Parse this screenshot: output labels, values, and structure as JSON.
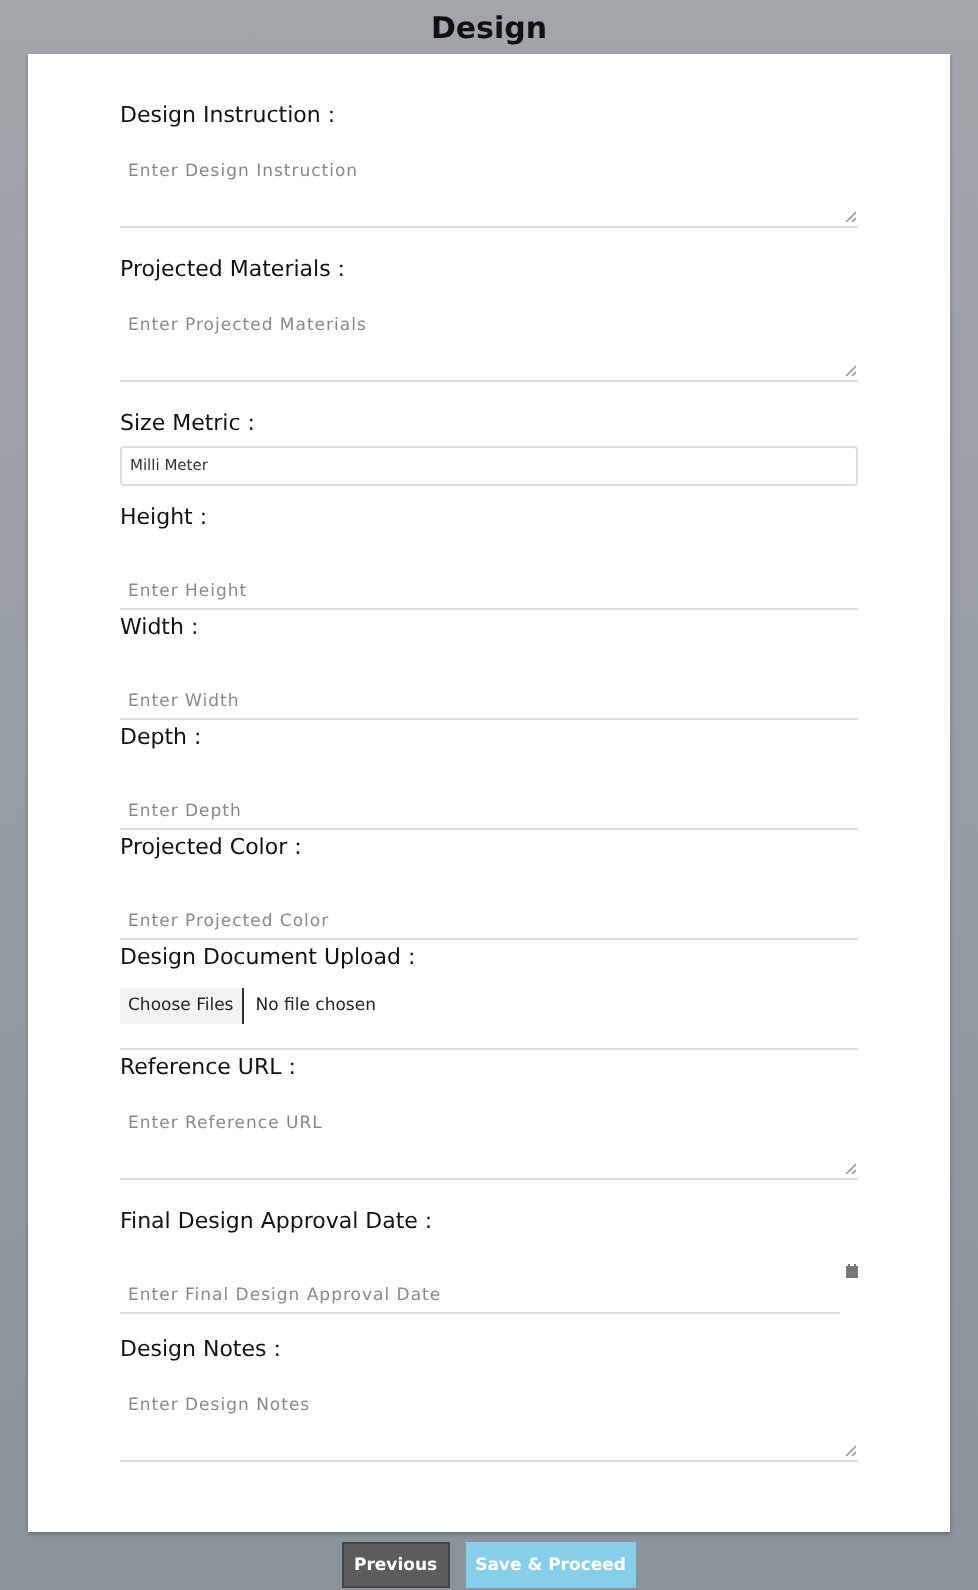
{
  "title": "Design",
  "fields": [
    {
      "kind": "textarea",
      "label": "Design Instruction :",
      "placeholder": "Enter Design Instruction"
    },
    {
      "kind": "textarea",
      "label": "Projected Materials :",
      "placeholder": "Enter Projected Materials"
    },
    {
      "kind": "select",
      "label": "Size Metric :",
      "value": "Milli Meter"
    },
    {
      "kind": "input",
      "label": "Height :",
      "placeholder": "Enter Height"
    },
    {
      "kind": "input",
      "label": "Width :",
      "placeholder": "Enter Width"
    },
    {
      "kind": "input",
      "label": "Depth :",
      "placeholder": "Enter Depth"
    },
    {
      "kind": "input",
      "label": "Projected Color :",
      "placeholder": "Enter Projected Color"
    },
    {
      "kind": "file",
      "label": "Design Document Upload :",
      "button": "Choose Files",
      "status": "No file chosen"
    },
    {
      "kind": "textarea",
      "label": "Reference URL :",
      "placeholder": "Enter Reference URL"
    },
    {
      "kind": "date",
      "label": "Final Design Approval Date :",
      "placeholder": "Enter Final Design Approval Date"
    },
    {
      "kind": "textarea",
      "label": "Design Notes :",
      "placeholder": "Enter Design Notes"
    }
  ],
  "buttons": [
    {
      "kind": "secondary",
      "label": "Previous"
    },
    {
      "kind": "primary",
      "label": "Save & Proceed"
    }
  ]
}
